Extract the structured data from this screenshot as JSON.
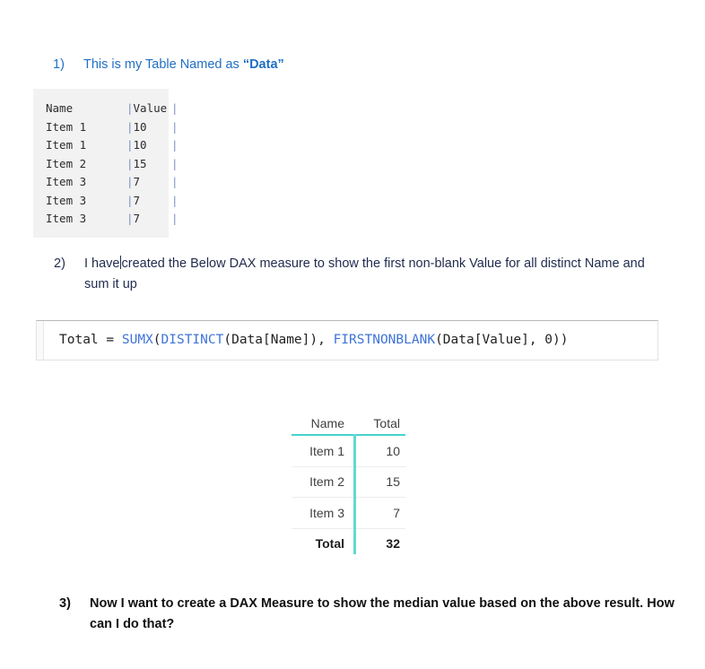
{
  "document": {
    "items": [
      {
        "marker": "1)",
        "text_before": "This is my Table Named as ",
        "emphasis": "“Data”",
        "text_after": ""
      },
      {
        "marker": "2)",
        "line1_a": "I have",
        "line1_b": "created the Below DAX measure to show the first non-blank Value for all distinct",
        "line2": "Name and sum it up"
      },
      {
        "marker": "3)",
        "line1": "Now I want to create a DAX Measure to show the median value based on the above result.",
        "line2": "How can I do that?"
      }
    ]
  },
  "source_table": {
    "header": {
      "name": "Name",
      "value": "Value"
    },
    "separator": "|",
    "rows": [
      {
        "name": "Item 1",
        "value": "10"
      },
      {
        "name": "Item 1",
        "value": "10"
      },
      {
        "name": "Item 2",
        "value": "15"
      },
      {
        "name": "Item 3",
        "value": "7"
      },
      {
        "name": "Item 3",
        "value": "7"
      },
      {
        "name": "Item 3",
        "value": "7"
      }
    ]
  },
  "formula": {
    "measure_name": "Total",
    "assign": " = ",
    "fn1": "SUMX",
    "p1": "(",
    "fn2": "DISTINCT",
    "p2": "(Data[Name]), ",
    "fn3": "FIRSTNONBLANK",
    "p3": "(Data[Value], 0))",
    "full_text": "Total = SUMX(DISTINCT(Data[Name]), FIRSTNONBLANK(Data[Value], 0))",
    "function_color": "#3f74d8"
  },
  "result_table": {
    "columns": [
      "Name",
      "Total"
    ],
    "rows": [
      {
        "name": "Item 1",
        "total": "10"
      },
      {
        "name": "Item 2",
        "total": "15"
      },
      {
        "name": "Item 3",
        "total": "7"
      }
    ],
    "total_row": {
      "name": "Total",
      "total": "32"
    },
    "accent_color": "#45d4cb"
  },
  "chart_data": {
    "type": "table",
    "title": "",
    "categories": [
      "Item 1",
      "Item 2",
      "Item 3",
      "Total"
    ],
    "values": [
      10,
      15,
      7,
      32
    ],
    "columns": [
      "Name",
      "Total"
    ],
    "xlabel": "Name",
    "ylabel": "Total"
  }
}
